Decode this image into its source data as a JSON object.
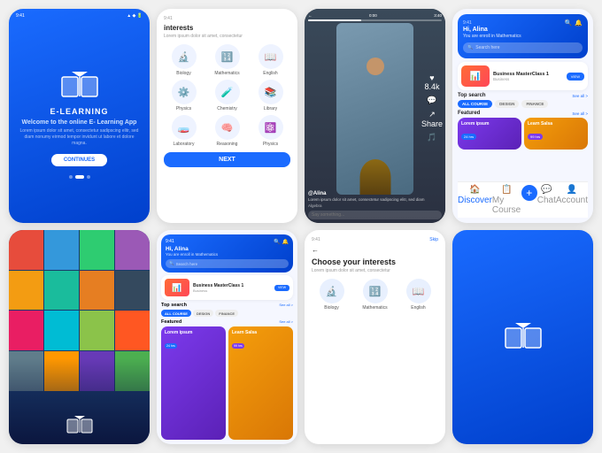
{
  "cards": {
    "elearning": {
      "status_time": "9:41",
      "title": "E-LEARNING",
      "welcome": "Welcome to the online E- Learning App",
      "description": "Lorem ipsum dolor sit amet, consectetur sadipscing elitr, sed diam nonumy eirmod tempor invidunt ut labore et dolore magna.",
      "btn_continues": "CONTINUES",
      "dots": [
        false,
        true,
        false
      ]
    },
    "interests": {
      "title": "interests",
      "subtitle": "Lorem ipsum dolor sit amet, consectetur",
      "items": [
        {
          "label": "Biology",
          "icon": "🔬"
        },
        {
          "label": "Mathematics",
          "icon": "🔢"
        },
        {
          "label": "English",
          "icon": "📖"
        },
        {
          "label": "Physics",
          "icon": "⚙️"
        },
        {
          "label": "Chemistry",
          "icon": "🧪"
        },
        {
          "label": "Library",
          "icon": "📚"
        },
        {
          "label": "Laboratory",
          "icon": "🧫"
        },
        {
          "label": "Reasoning",
          "icon": "🧠"
        },
        {
          "label": "Physics",
          "icon": "⚛️"
        }
      ],
      "btn_next": "NEXT"
    },
    "video": {
      "time_start": "0:00",
      "time_end": "3:40",
      "user": "@Alina",
      "description": "Lorem ipsum dolor sit amet, consectetur sadipscing elitr, sed diam",
      "subject": "Algebra",
      "comment_placeholder": "Say something...",
      "actions": [
        {
          "icon": "♥",
          "label": "8.4k"
        },
        {
          "icon": "💬",
          "label": ""
        },
        {
          "icon": "↗",
          "label": "Share"
        },
        {
          "icon": "🎵",
          "label": ""
        }
      ]
    },
    "dashboard": {
      "status_time": "9:41",
      "greeting": "Hi, Alina",
      "enrolled": "You are enroll in Mathematics",
      "search_placeholder": "Search here",
      "course": {
        "title": "Business MasterClass 1",
        "category": "Business",
        "btn": "VIEW"
      },
      "top_search_label": "Top search",
      "see_all": "See all >",
      "featured_label": "Featured",
      "tabs": [
        "ALL COURSE",
        "DESIGN",
        "FINANCE"
      ],
      "active_tab": 0,
      "featured_items": [
        {
          "title": "Lorem ipsum",
          "badge": "24 hrs",
          "badge_type": "b24"
        },
        {
          "title": "Learn Salsa",
          "badge": "99 hrs",
          "badge_type": "b99"
        }
      ],
      "nav": [
        "Discover",
        "My Course",
        "",
        "Chat",
        "Account"
      ]
    },
    "books": {
      "colors": [
        "#e74c3c",
        "#3498db",
        "#2ecc71",
        "#9b59b6",
        "#f39c12",
        "#1abc9c",
        "#e67e22",
        "#34495e",
        "#e91e63",
        "#00bcd4",
        "#8bc34a",
        "#ff5722",
        "#607d8b",
        "#ff9800",
        "#673ab7",
        "#4caf50"
      ]
    },
    "choose_interests": {
      "title": "Choose your interests",
      "subtitle": "Lorem ipsum dolor sit amet, consectetur",
      "items": [
        {
          "label": "Biology",
          "icon": "🔬"
        },
        {
          "label": "Mathematics",
          "icon": "🔢"
        },
        {
          "label": "English",
          "icon": "📖"
        }
      ]
    }
  }
}
